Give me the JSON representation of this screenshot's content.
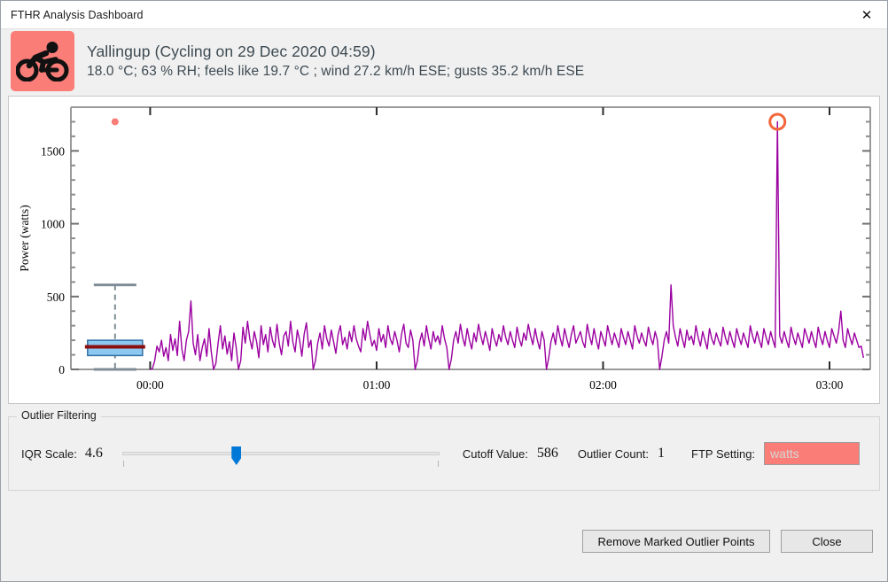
{
  "window": {
    "title": "FTHR Analysis Dashboard",
    "close_icon": "close-icon",
    "close_glyph": "✕"
  },
  "header": {
    "sport_icon": "cyclist-icon",
    "icon_bg": "#fa7d78",
    "line1": "Yallingup (Cycling on 29 Dec 2020 04:59)",
    "line2": "18.0 °C; 63 % RH; feels like 19.7 °C ; wind 27.2 km/h ESE; gusts 35.2 km/h ESE"
  },
  "chart_data": {
    "type": "line",
    "title": "",
    "xlabel": "",
    "ylabel": "Power (watts)",
    "ylim": [
      0,
      1800
    ],
    "xlim": [
      -0.35,
      3.18
    ],
    "grid": false,
    "legend": "none",
    "yticks": [
      0,
      500,
      1000,
      1500
    ],
    "yticklabels": [
      "0",
      "500",
      "1000",
      "1500"
    ],
    "yminorticks": [
      100,
      200,
      300,
      400,
      600,
      700,
      800,
      900,
      1100,
      1200,
      1300,
      1400,
      1600,
      1700
    ],
    "xticks": [
      0,
      1,
      2,
      3
    ],
    "xticklabels": [
      "00:00",
      "01:00",
      "02:00",
      "03:00"
    ],
    "line_color": "#9b00a0",
    "marked_outlier": {
      "x": 2.77,
      "y": 1700,
      "color": "#f4663a",
      "label": "marked-outlier"
    },
    "boxplot": {
      "x": -0.155,
      "q1": 95,
      "median": 155,
      "q3": 200,
      "whisker_low": 0,
      "whisker_high": 580,
      "box_color": "#8cc8f0",
      "box_edge": "#2f6ea5",
      "median_color": "#8b0f0f",
      "whisker_color": "#7f8c96",
      "outliers": [
        1700
      ],
      "outlier_color": "#fa7d78"
    },
    "series": [
      {
        "name": "Power",
        "x": [
          0.0,
          0.01,
          0.02,
          0.03,
          0.04,
          0.05,
          0.06,
          0.07,
          0.08,
          0.09,
          0.1,
          0.11,
          0.12,
          0.13,
          0.14,
          0.15,
          0.16,
          0.17,
          0.18,
          0.19,
          0.2,
          0.21,
          0.22,
          0.23,
          0.24,
          0.25,
          0.26,
          0.27,
          0.28,
          0.29,
          0.3,
          0.31,
          0.32,
          0.33,
          0.34,
          0.35,
          0.36,
          0.37,
          0.38,
          0.39,
          0.4,
          0.41,
          0.42,
          0.43,
          0.44,
          0.45,
          0.46,
          0.47,
          0.48,
          0.49,
          0.5,
          0.51,
          0.52,
          0.53,
          0.54,
          0.55,
          0.56,
          0.57,
          0.58,
          0.59,
          0.6,
          0.61,
          0.62,
          0.63,
          0.64,
          0.65,
          0.66,
          0.67,
          0.68,
          0.69,
          0.7,
          0.71,
          0.72,
          0.73,
          0.74,
          0.75,
          0.76,
          0.77,
          0.78,
          0.79,
          0.8,
          0.81,
          0.82,
          0.83,
          0.84,
          0.85,
          0.86,
          0.87,
          0.88,
          0.89,
          0.9,
          0.91,
          0.92,
          0.93,
          0.94,
          0.95,
          0.96,
          0.97,
          0.98,
          0.99,
          1.0,
          1.01,
          1.02,
          1.03,
          1.04,
          1.05,
          1.06,
          1.07,
          1.08,
          1.09,
          1.1,
          1.11,
          1.12,
          1.13,
          1.14,
          1.15,
          1.16,
          1.17,
          1.18,
          1.19,
          1.2,
          1.21,
          1.22,
          1.23,
          1.24,
          1.25,
          1.26,
          1.27,
          1.28,
          1.29,
          1.3,
          1.31,
          1.32,
          1.33,
          1.34,
          1.35,
          1.36,
          1.37,
          1.38,
          1.39,
          1.4,
          1.41,
          1.42,
          1.43,
          1.44,
          1.45,
          1.46,
          1.47,
          1.48,
          1.49,
          1.5,
          1.51,
          1.52,
          1.53,
          1.54,
          1.55,
          1.56,
          1.57,
          1.58,
          1.59,
          1.6,
          1.61,
          1.62,
          1.63,
          1.64,
          1.65,
          1.66,
          1.67,
          1.68,
          1.69,
          1.7,
          1.71,
          1.72,
          1.73,
          1.74,
          1.75,
          1.76,
          1.77,
          1.78,
          1.79,
          1.8,
          1.81,
          1.82,
          1.83,
          1.84,
          1.85,
          1.86,
          1.87,
          1.88,
          1.89,
          1.9,
          1.91,
          1.92,
          1.93,
          1.94,
          1.95,
          1.96,
          1.97,
          1.98,
          1.99,
          2.0,
          2.01,
          2.02,
          2.03,
          2.04,
          2.05,
          2.06,
          2.07,
          2.08,
          2.09,
          2.1,
          2.11,
          2.12,
          2.13,
          2.14,
          2.15,
          2.16,
          2.17,
          2.18,
          2.19,
          2.2,
          2.21,
          2.22,
          2.23,
          2.24,
          2.25,
          2.26,
          2.27,
          2.28,
          2.29,
          2.3,
          2.31,
          2.32,
          2.33,
          2.34,
          2.35,
          2.36,
          2.37,
          2.38,
          2.39,
          2.4,
          2.41,
          2.42,
          2.43,
          2.44,
          2.45,
          2.46,
          2.47,
          2.48,
          2.49,
          2.5,
          2.51,
          2.52,
          2.53,
          2.54,
          2.55,
          2.56,
          2.57,
          2.58,
          2.59,
          2.6,
          2.61,
          2.62,
          2.63,
          2.64,
          2.65,
          2.66,
          2.67,
          2.68,
          2.69,
          2.7,
          2.71,
          2.72,
          2.73,
          2.74,
          2.75,
          2.76,
          2.77,
          2.78,
          2.79,
          2.8,
          2.81,
          2.82,
          2.83,
          2.84,
          2.85,
          2.86,
          2.87,
          2.88,
          2.89,
          2.9,
          2.91,
          2.92,
          2.93,
          2.94,
          2.95,
          2.96,
          2.97,
          2.98,
          2.99,
          3.0,
          3.01,
          3.02,
          3.03,
          3.04,
          3.05,
          3.06,
          3.07,
          3.08,
          3.09,
          3.1,
          3.11,
          3.12,
          3.13,
          3.14,
          3.15
        ],
        "values": [
          0,
          5,
          60,
          160,
          120,
          200,
          90,
          150,
          60,
          240,
          130,
          210,
          95,
          330,
          140,
          60,
          200,
          260,
          470,
          180,
          100,
          240,
          60,
          150,
          210,
          90,
          280,
          120,
          0,
          40,
          180,
          300,
          140,
          230,
          105,
          190,
          60,
          250,
          150,
          0,
          60,
          290,
          180,
          330,
          210,
          140,
          260,
          190,
          80,
          300,
          170,
          240,
          120,
          290,
          200,
          150,
          310,
          180,
          100,
          230,
          260,
          160,
          330,
          190,
          120,
          270,
          200,
          90,
          240,
          320,
          150,
          200,
          0,
          60,
          180,
          250,
          140,
          300,
          210,
          160,
          270,
          190,
          110,
          240,
          300,
          170,
          220,
          140,
          260,
          190,
          300,
          210,
          160,
          120,
          280,
          200,
          330,
          240,
          160,
          200,
          130,
          280,
          190,
          240,
          150,
          300,
          210,
          170,
          260,
          200,
          120,
          240,
          310,
          180,
          150,
          270,
          200,
          0,
          60,
          190,
          250,
          160,
          300,
          210,
          140,
          260,
          190,
          230,
          170,
          300,
          210,
          150,
          0,
          70,
          200,
          260,
          180,
          310,
          220,
          160,
          280,
          200,
          140,
          250,
          190,
          310,
          230,
          170,
          260,
          200,
          130,
          280,
          210,
          160,
          240,
          190,
          300,
          220,
          170,
          260,
          200,
          150,
          290,
          210,
          160,
          250,
          200,
          310,
          230,
          170,
          280,
          200,
          140,
          260,
          200,
          0,
          80,
          190,
          250,
          170,
          300,
          220,
          160,
          280,
          210,
          150,
          240,
          300,
          180,
          220,
          260,
          190,
          150,
          310,
          230,
          170,
          280,
          200,
          140,
          260,
          210,
          160,
          300,
          230,
          170,
          250,
          200,
          150,
          280,
          220,
          170,
          260,
          200,
          140,
          300,
          230,
          180,
          250,
          200,
          160,
          290,
          220,
          170,
          260,
          200,
          0,
          90,
          200,
          260,
          180,
          580,
          300,
          220,
          160,
          280,
          210,
          150,
          270,
          200,
          230,
          170,
          300,
          220,
          160,
          260,
          200,
          140,
          280,
          210,
          170,
          250,
          200,
          160,
          290,
          220,
          170,
          260,
          200,
          150,
          280,
          220,
          170,
          250,
          200,
          150,
          300,
          230,
          180,
          260,
          200,
          150,
          280,
          220,
          170,
          260,
          200,
          150,
          1700,
          230,
          180,
          260,
          200,
          150,
          290,
          220,
          170,
          250,
          200,
          150,
          280,
          230,
          180,
          260,
          200,
          150,
          290,
          220,
          170,
          260,
          200,
          150,
          280,
          230,
          180,
          260,
          400,
          200,
          150,
          280,
          220,
          170,
          250,
          200,
          150,
          160,
          80,
          20
        ]
      }
    ]
  },
  "outlier_filtering": {
    "legend": "Outlier Filtering",
    "iqr_scale_label": "IQR Scale:",
    "iqr_scale_value": "4.6",
    "slider_name": "iqr-scale-slider",
    "slider_position_pct": 36,
    "cutoff_label": "Cutoff Value:",
    "cutoff_value": "586",
    "outlier_count_label": "Outlier Count:",
    "outlier_count_value": "1",
    "ftp_label": "FTP Setting:",
    "ftp_placeholder": "watts",
    "ftp_value": "",
    "ftp_bg": "#fa7d78"
  },
  "buttons": {
    "remove_outliers": "Remove Marked Outlier Points",
    "close": "Close"
  }
}
